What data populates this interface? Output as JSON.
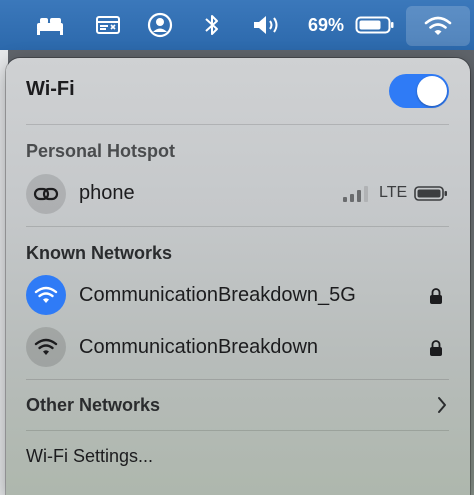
{
  "menubar": {
    "battery_percent": "69%",
    "icons": [
      "bed-icon",
      "display-icon",
      "user-icon",
      "bluetooth-icon",
      "volume-icon",
      "battery-icon",
      "wifi-icon"
    ]
  },
  "panel": {
    "title": "Wi-Fi",
    "wifi_enabled": true,
    "personal_hotspot": {
      "header": "Personal Hotspot",
      "device_name": "phone",
      "network_type": "LTE"
    },
    "known_networks": {
      "header": "Known Networks",
      "items": [
        {
          "name": "CommunicationBreakdown_5G",
          "connected": true,
          "locked": true
        },
        {
          "name": "CommunicationBreakdown",
          "connected": false,
          "locked": true
        }
      ]
    },
    "other_networks_label": "Other Networks",
    "settings_label": "Wi-Fi Settings..."
  },
  "colors": {
    "menubar": "#2f6fb4",
    "accent": "#2f7bf6"
  }
}
